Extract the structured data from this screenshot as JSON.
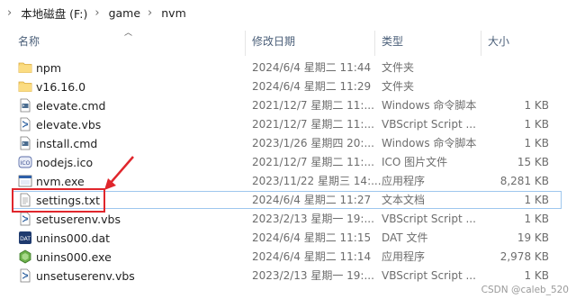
{
  "breadcrumb": {
    "items": [
      "本地磁盘 (F:)",
      "game",
      "nvm"
    ]
  },
  "columns": {
    "name": "名称",
    "date": "修改日期",
    "type": "类型",
    "size": "大小"
  },
  "files": [
    {
      "name": "npm",
      "date": "2024/6/4 星期二 11:44",
      "type": "文件夹",
      "size": "",
      "icon": "folder-icon"
    },
    {
      "name": "v16.16.0",
      "date": "2024/6/4 星期二 11:29",
      "type": "文件夹",
      "size": "",
      "icon": "folder-icon"
    },
    {
      "name": "elevate.cmd",
      "date": "2021/12/7 星期二 11:...",
      "type": "Windows 命令脚本",
      "size": "1 KB",
      "icon": "cmd-file-icon"
    },
    {
      "name": "elevate.vbs",
      "date": "2021/12/7 星期二 11:...",
      "type": "VBScript Script ...",
      "size": "1 KB",
      "icon": "vbs-file-icon"
    },
    {
      "name": "install.cmd",
      "date": "2023/1/26 星期四 20:...",
      "type": "Windows 命令脚本",
      "size": "1 KB",
      "icon": "cmd-file-icon"
    },
    {
      "name": "nodejs.ico",
      "date": "2021/12/7 星期二 11:...",
      "type": "ICO 图片文件",
      "size": "15 KB",
      "icon": "ico-file-icon"
    },
    {
      "name": "nvm.exe",
      "date": "2023/11/22 星期三 14:...",
      "type": "应用程序",
      "size": "8,281 KB",
      "icon": "exe-file-icon"
    },
    {
      "name": "settings.txt",
      "date": "2024/6/4 星期二 11:27",
      "type": "文本文档",
      "size": "1 KB",
      "icon": "txt-file-icon"
    },
    {
      "name": "setuserenv.vbs",
      "date": "2023/2/13 星期一 19:...",
      "type": "VBScript Script ...",
      "size": "1 KB",
      "icon": "vbs-file-icon"
    },
    {
      "name": "unins000.dat",
      "date": "2024/6/4 星期二 11:15",
      "type": "DAT 文件",
      "size": "19 KB",
      "icon": "dat-file-icon"
    },
    {
      "name": "unins000.exe",
      "date": "2024/6/4 星期二 11:14",
      "type": "应用程序",
      "size": "2,978 KB",
      "icon": "installer-exe-icon"
    },
    {
      "name": "unsetuserenv.vbs",
      "date": "2023/2/13 星期一 19:...",
      "type": "VBScript Script ...",
      "size": "1 KB",
      "icon": "vbs-file-icon"
    }
  ],
  "watermark": "CSDN @caleb_520",
  "colors": {
    "annotation_red": "#e0262c",
    "folder_yellow": "#f8d775",
    "selection_border": "#9ec7ee"
  }
}
